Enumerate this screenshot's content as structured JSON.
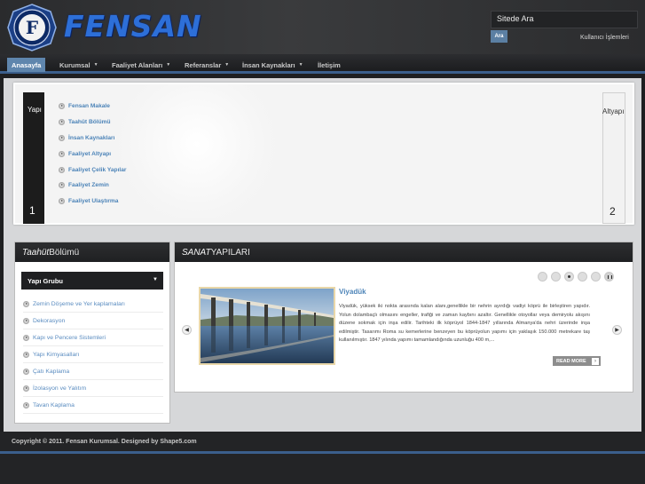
{
  "header": {
    "logo_text": "FENSAN",
    "logo_letter": "F",
    "search": {
      "value": "Sitede Ara",
      "button": "Ara"
    },
    "user_link": "Kullanıcı İşlemleri"
  },
  "nav": {
    "items": [
      {
        "label": "Anasayfa",
        "active": true,
        "dropdown": false
      },
      {
        "label": "Kurumsal",
        "dropdown": true
      },
      {
        "label": "Faaliyet Alanları",
        "dropdown": true
      },
      {
        "label": "Referanslar",
        "dropdown": true
      },
      {
        "label": "İnsan Kaynakları",
        "dropdown": true
      },
      {
        "label": "İletişim",
        "dropdown": false
      }
    ]
  },
  "slider": {
    "left_panel": {
      "title": "Yapı",
      "number": "1"
    },
    "right_panel": {
      "title": "Altyapı",
      "number": "2"
    },
    "links": [
      "Fensan Makale",
      "Taahüt Bölümü",
      "İnsan Kaynakları",
      "Faaliyet Altyapı",
      "Faaliyet Çelik Yapılar",
      "Faaliyet Zemin",
      "Faaliyet Ulaştırma"
    ]
  },
  "left_box": {
    "title_italic": "Taahüt",
    "title_rest": " Bölümü",
    "dropdown_label": "Yapı Grubu",
    "items": [
      "Zemin Döşeme ve Yer kaplamaları",
      "Dekorasyon",
      "Kapı ve Pencere Sistemleri",
      "Yapı Kimyasalları",
      "Çatı Kaplama",
      "İzolasyon ve Yalıtım",
      "Tavan Kaplama"
    ]
  },
  "right_box": {
    "title_italic": "SANAT",
    "title_rest": " YAPILARI",
    "article": {
      "title": "Viyadük",
      "body": "Viyadük, yüksek iki nokta arasında kalan alanı,genellikle bir nehrin ayırdığı vadiyi köprü ile birleştiren yapıdır. Yolun dolambaçlı olmasını engeller, trafiği ve zaman kaybını azaltır. Genellikle otoyollar veya demiryolu akışını düzene sokmak için inşa edilir. Tarihteki ilk köprüyol 1844-1847 yıllarında Almanya'da nehri üzerinde inşa edilmiştir. Tasarımı Roma su kemerlerine benzeyen bu köprüyolun yapımı için yaklaşık 150.000 metrekare taş kullanılmıştır. 1847 yılında yapımı tamamlandığında uzunluğu 400 m,...",
      "read_more": "READ MORE"
    },
    "dots": 5,
    "active_dot": 3
  },
  "footer": {
    "copyright": "Copyright © 2011. Fensan Kurumsal. Designed by Shape5.com"
  },
  "colors": {
    "accent": "#3b5f8c",
    "link": "#4d84b8",
    "logo": "#2d6fd8"
  }
}
